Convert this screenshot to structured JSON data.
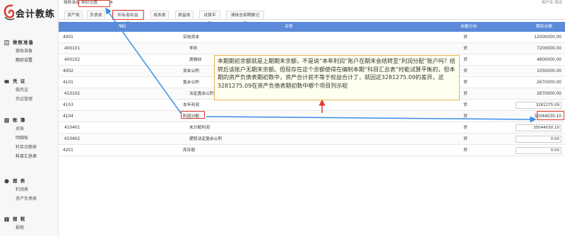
{
  "app": {
    "logo_text": "会计教练"
  },
  "topbar": {
    "tabs": [
      {
        "label": "做账准备"
      },
      {
        "label": "期初设置"
      }
    ],
    "user_info": "用户名 测试"
  },
  "sidebar": {
    "groups": [
      {
        "title": "做账准备",
        "icon": "document-icon",
        "items": [
          "做账准备",
          "期初设置"
        ]
      },
      {
        "title": "凭 证",
        "icon": "voucher-icon",
        "items": [
          "做凭证",
          "凭证管理"
        ]
      },
      {
        "title": "账 簿",
        "icon": "ledger-icon",
        "items": [
          "总账",
          "明细账",
          "科目余额表",
          "科目汇总表"
        ]
      },
      {
        "title": "报 表",
        "icon": "report-icon",
        "items": [
          "利润表",
          "资产负债表"
        ]
      },
      {
        "title": "报 税",
        "icon": "tax-icon",
        "items": [
          "报税"
        ]
      }
    ]
  },
  "subtabs": [
    "资产类",
    "负债类",
    "所有者权益类",
    "成本类",
    "损益类",
    "试算平衡",
    "清除全部期数记录"
  ],
  "table": {
    "headers": {
      "code": "编码",
      "name": "名称",
      "direction": "余额方向",
      "balance": "期初余额"
    },
    "rows": [
      {
        "code": "4001",
        "name": "实收资本",
        "direction": "贷",
        "balance": "12000000.00"
      },
      {
        "code": "400101",
        "name": "李凯",
        "direction": "贷",
        "balance": "7200000.00"
      },
      {
        "code": "400102",
        "name": "周雅欣",
        "direction": "贷",
        "balance": "4800000.00"
      },
      {
        "code": "4002",
        "name": "资本公积",
        "direction": "贷",
        "balance": "1050000.00"
      },
      {
        "code": "4101",
        "name": "盈余公积",
        "direction": "贷",
        "balance": "2670000.00"
      },
      {
        "code": "410102",
        "name": "法定盈余公积",
        "direction": "贷",
        "balance": "2670000.00"
      },
      {
        "code": "4103",
        "name": "本年利润",
        "direction": "贷",
        "balance": "3281275.09"
      },
      {
        "code": "4104",
        "name": "利润分配",
        "direction": "贷",
        "balance": "35044030.10"
      },
      {
        "code": "410401",
        "name": "未分配利润",
        "direction": "贷",
        "balance": "35044030.10"
      },
      {
        "code": "410402",
        "name": "提取法定盈余公积",
        "direction": "贷",
        "balance": "0.00"
      },
      {
        "code": "4201",
        "name": "库存股",
        "direction": "贷",
        "balance": "0.00"
      }
    ]
  },
  "annotation": {
    "text": "本期期初余额就是上期期末余额，不是说“本年利润”账户在期末会结转至“利润分配”账户吗？结转后该账户无期末余额。但现存在这个余额使得在编制本期“科目汇总表”时能试算平衡的，但本期的资产负债表期初数中，资产合计就不等于权益合计了，就因这3281275.09的差异，这3281275.09在资产负债表期初数中哪个项目列示呢",
    "highlight_color": "#e03a2e",
    "arrow_color": "#3a8ee6"
  },
  "colors": {
    "header_bg": "#5b8ad8",
    "callout_border": "#e8b24a"
  }
}
